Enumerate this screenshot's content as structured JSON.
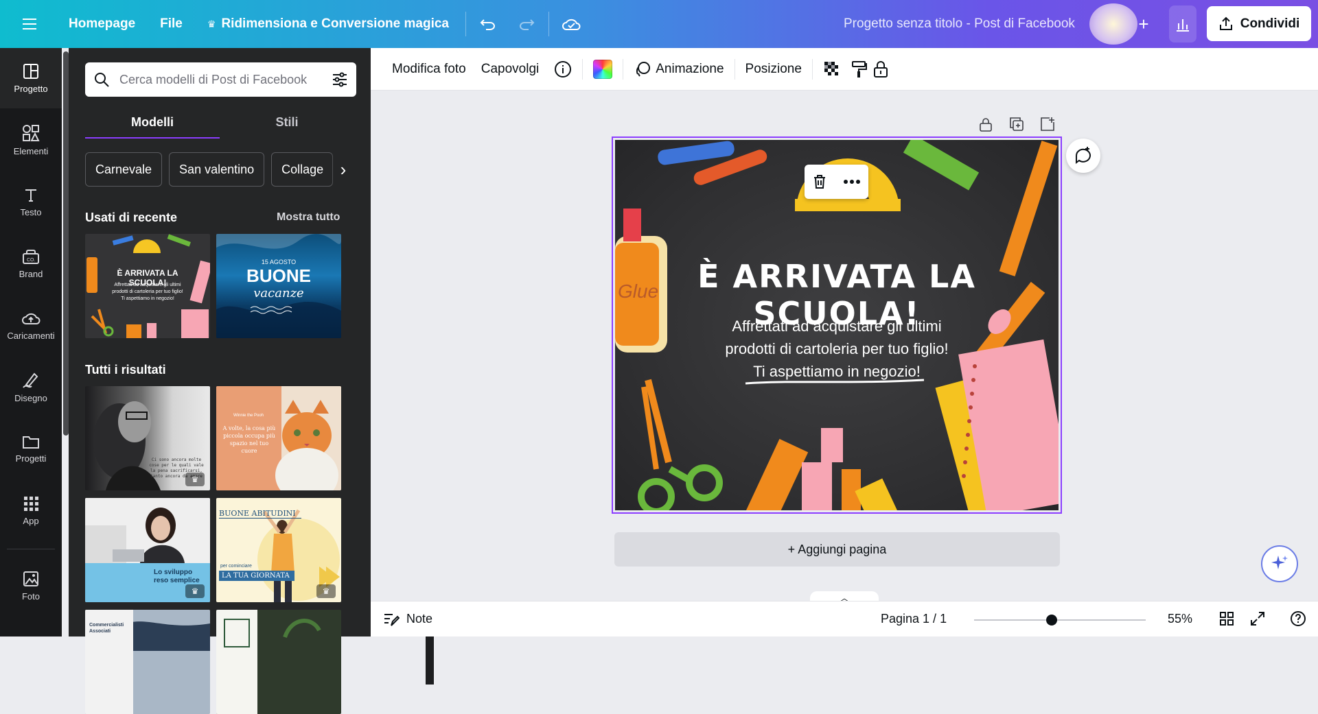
{
  "topbar": {
    "menu_icon": "hamburger-icon",
    "home": "Homepage",
    "file": "File",
    "magic_resize": "Ridimensiona e Conversione magica",
    "undo_icon": "undo-icon",
    "redo_icon": "redo-icon",
    "cloud_icon": "cloud-check-icon",
    "title": "Progetto senza titolo - Post di Facebook",
    "add_icon": "plus-icon",
    "insights_icon": "bar-chart-icon",
    "share": "Condividi"
  },
  "rail": {
    "items": [
      {
        "label": "Progetto",
        "icon": "layout-icon"
      },
      {
        "label": "Elementi",
        "icon": "shapes-icon"
      },
      {
        "label": "Testo",
        "icon": "text-icon"
      },
      {
        "label": "Brand",
        "icon": "brand-icon"
      },
      {
        "label": "Caricamenti",
        "icon": "cloud-upload-icon"
      },
      {
        "label": "Disegno",
        "icon": "draw-icon"
      },
      {
        "label": "Progetti",
        "icon": "folder-icon"
      },
      {
        "label": "App",
        "icon": "apps-grid-icon"
      },
      {
        "label": "Foto",
        "icon": "photo-icon"
      }
    ]
  },
  "panel": {
    "search_placeholder": "Cerca modelli di Post di Facebook",
    "tabs": [
      "Modelli",
      "Stili"
    ],
    "chips": [
      "Carnevale",
      "San valentino",
      "Collage"
    ],
    "recent_title": "Usati di recente",
    "show_all": "Mostra tutto",
    "all_results_title": "Tutti i risultati",
    "recent": [
      {
        "title": "È ARRIVATA LA SCUOLA!",
        "body": "Affrettati ad acquistare gli ultimi prodotti di cartoleria per tuo figlio! Ti aspettiamo in negozio!"
      },
      {
        "kicker": "15 AGOSTO",
        "title": "BUONE",
        "script": "vacanze"
      }
    ],
    "results": [
      {
        "text": "Ci sono ancora molte cose per le quali vale la pena sacrificarsi, tanto ancora da amare"
      },
      {
        "kicker": "Winnie the Pooh",
        "text": "A volte, la cosa più piccola occupa più spazio nel tuo cuore",
        "author": "Winnie the Pooh"
      },
      {
        "title": "Lo sviluppo reso semplice"
      },
      {
        "title": "BUONE ABITUDINI",
        "kicker": "per cominciare",
        "banner": "LA TUA GIORNATA"
      },
      {
        "title": "Commercialisti Associati"
      },
      {
        "title": ""
      }
    ]
  },
  "toolbar": {
    "edit_photo": "Modifica foto",
    "flip": "Capovolgi",
    "info_icon": "info-icon",
    "color_icon": "color-swatch-icon",
    "animate": "Animazione",
    "position": "Posizione",
    "transparency_icon": "transparency-icon",
    "paint_icon": "paint-roller-icon",
    "lock_icon": "lock-icon"
  },
  "design": {
    "headline": "È ARRIVATA LA SCUOLA!",
    "line1": "Affrettati ad acquistare gli ultimi",
    "line2": "prodotti di cartoleria per tuo figlio!",
    "line3": "Ti aspettiamo in negozio!",
    "glue_label": "Glue"
  },
  "canvas": {
    "add_page": "+ Aggiungi pagina"
  },
  "statusbar": {
    "notes": "Note",
    "page": "Pagina 1 / 1",
    "zoom": "55%",
    "zoom_fraction": 0.45
  },
  "colors": {
    "accent": "#8b3dff",
    "rail_bg": "#18191b",
    "panel_bg": "#252627",
    "canvas_bg": "#ebecf0"
  }
}
